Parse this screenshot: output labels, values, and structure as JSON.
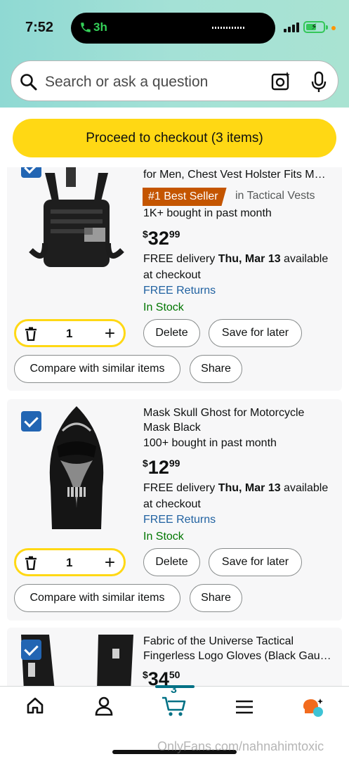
{
  "status_bar": {
    "time": "7:52",
    "call_duration": "3h"
  },
  "search": {
    "placeholder": "Search or ask a question"
  },
  "checkout": {
    "label": "Proceed to checkout (3 items)"
  },
  "items": [
    {
      "title": "for Men, Chest Vest Holster Fits M…",
      "badge": "#1 Best Seller",
      "badge_category": "in Tactical Vests",
      "bought": "1K+ bought in past month",
      "price_currency": "$",
      "price_whole": "32",
      "price_cents": "99",
      "delivery_prefix": "FREE delivery ",
      "delivery_date": "Thu, Mar 13",
      "delivery_suffix": " available at checkout",
      "returns": "FREE Returns",
      "stock": "In Stock",
      "quantity": "1",
      "delete_label": "Delete",
      "save_label": "Save for later",
      "compare_label": "Compare with similar items",
      "share_label": "Share",
      "checked": true
    },
    {
      "title": "Mask Skull Ghost for Motorcycle Mask Black",
      "bought": "100+ bought in past month",
      "price_currency": "$",
      "price_whole": "12",
      "price_cents": "99",
      "delivery_prefix": "FREE delivery ",
      "delivery_date": "Thu, Mar 13",
      "delivery_suffix": " available at checkout",
      "returns": "FREE Returns",
      "stock": "In Stock",
      "quantity": "1",
      "delete_label": "Delete",
      "save_label": "Save for later",
      "compare_label": "Compare with similar items",
      "share_label": "Share",
      "checked": true
    },
    {
      "title": "Fabric of the Universe Tactical Fingerless Logo Gloves (Black Gau…",
      "price_currency": "$",
      "price_whole": "34",
      "price_cents": "50",
      "checked": true
    }
  ],
  "tabbar": {
    "cart_count": "3"
  },
  "watermark": "OnlyFans.com/nahnahimtoxic",
  "colors": {
    "accent_yellow": "#ffd814",
    "badge_orange": "#c45500",
    "link_blue": "#2162a1",
    "stock_green": "#007600",
    "checkbox_blue": "#2265b3",
    "teal": "#007185"
  }
}
